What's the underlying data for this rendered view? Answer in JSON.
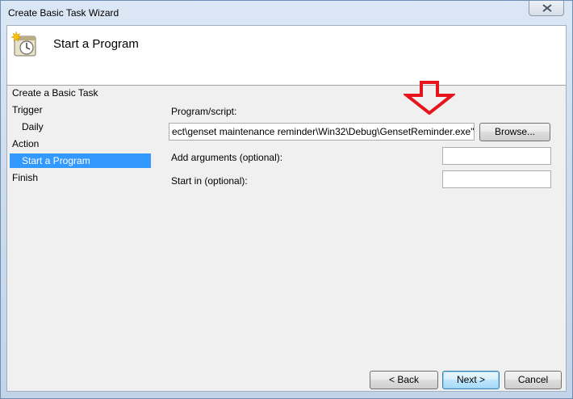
{
  "window": {
    "title": "Create Basic Task Wizard"
  },
  "header": {
    "title": "Start a Program",
    "icon": "task-scheduler-icon"
  },
  "nav": {
    "items": [
      {
        "label": "Create a Basic Task",
        "indent": false,
        "selected": false
      },
      {
        "label": "Trigger",
        "indent": false,
        "selected": false
      },
      {
        "label": "Daily",
        "indent": true,
        "selected": false
      },
      {
        "label": "Action",
        "indent": false,
        "selected": false
      },
      {
        "label": "Start a Program",
        "indent": true,
        "selected": true
      },
      {
        "label": "Finish",
        "indent": false,
        "selected": false
      }
    ]
  },
  "form": {
    "program_label": "Program/script:",
    "program_value": "ect\\genset maintenance reminder\\Win32\\Debug\\GensetReminder.exe\"",
    "browse_label": "Browse...",
    "arguments_label": "Add arguments (optional):",
    "arguments_value": "",
    "startin_label": "Start in (optional):",
    "startin_value": ""
  },
  "annotation": {
    "arrow_color": "#e8141b"
  },
  "footer": {
    "back_label": "< Back",
    "next_label": "Next >",
    "cancel_label": "Cancel"
  },
  "colors": {
    "selection": "#3399ff",
    "window_frame": "#cfdded"
  }
}
